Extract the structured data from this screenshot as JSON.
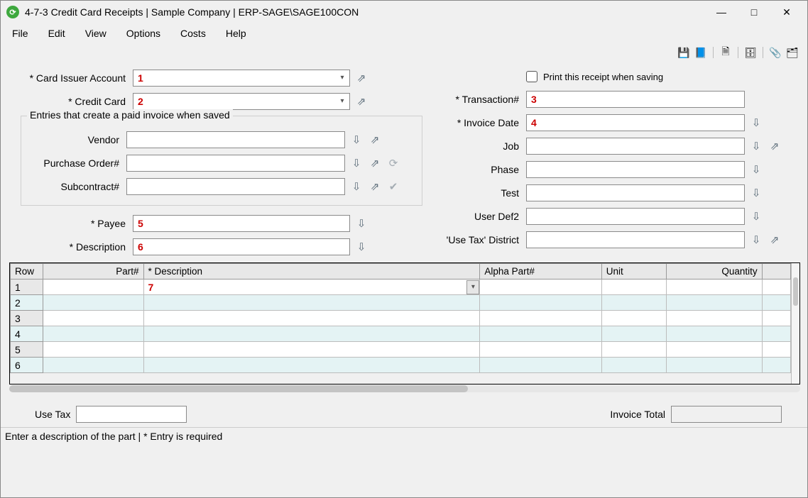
{
  "window": {
    "title": "4-7-3 Credit Card Receipts  |  Sample Company  |  ERP-SAGE\\SAGE100CON",
    "app_icon_glyph": "⟳"
  },
  "menu": {
    "file": "File",
    "edit": "Edit",
    "view": "View",
    "options": "Options",
    "costs": "Costs",
    "help": "Help"
  },
  "toolbar": {
    "save": "💾",
    "book": "📘",
    "new": "🗎",
    "lookup": "🗄",
    "attach": "📎",
    "note": "🗂"
  },
  "labels": {
    "card_issuer": "* Card Issuer Account",
    "credit_card": "* Credit Card",
    "entries_group": "Entries that create a paid invoice when saved",
    "vendor": "Vendor",
    "purchase_order": "Purchase Order#",
    "subcontract": "Subcontract#",
    "payee": "* Payee",
    "description": "* Description",
    "print_receipt": "Print this receipt when saving",
    "transaction": "* Transaction#",
    "invoice_date": "* Invoice Date",
    "job": "Job",
    "phase": "Phase",
    "test": "Test",
    "user_def2": "User Def2",
    "use_tax_district": "'Use Tax' District",
    "use_tax": "Use Tax",
    "invoice_total": "Invoice Total"
  },
  "values": {
    "card_issuer": "1",
    "credit_card": "2",
    "vendor": "",
    "purchase_order": "",
    "subcontract": "",
    "payee": "5",
    "description": "6",
    "transaction": "3",
    "invoice_date": "4",
    "job": "",
    "phase": "",
    "test": "",
    "user_def2": "",
    "use_tax_district": "",
    "use_tax": "",
    "invoice_total": ""
  },
  "grid": {
    "columns": {
      "row": "Row",
      "part": "Part#",
      "description": "* Description",
      "alpha_part": "Alpha Part#",
      "unit": "Unit",
      "quantity": "Quantity"
    },
    "rows": [
      {
        "n": "1",
        "part": "",
        "description": "7",
        "alpha": "",
        "unit": "",
        "qty": ""
      },
      {
        "n": "2",
        "part": "",
        "description": "",
        "alpha": "",
        "unit": "",
        "qty": ""
      },
      {
        "n": "3",
        "part": "",
        "description": "",
        "alpha": "",
        "unit": "",
        "qty": ""
      },
      {
        "n": "4",
        "part": "",
        "description": "",
        "alpha": "",
        "unit": "",
        "qty": ""
      },
      {
        "n": "5",
        "part": "",
        "description": "",
        "alpha": "",
        "unit": "",
        "qty": ""
      },
      {
        "n": "6",
        "part": "",
        "description": "",
        "alpha": "",
        "unit": "",
        "qty": ""
      }
    ]
  },
  "status": "Enter a description of the part   |   * Entry is required"
}
